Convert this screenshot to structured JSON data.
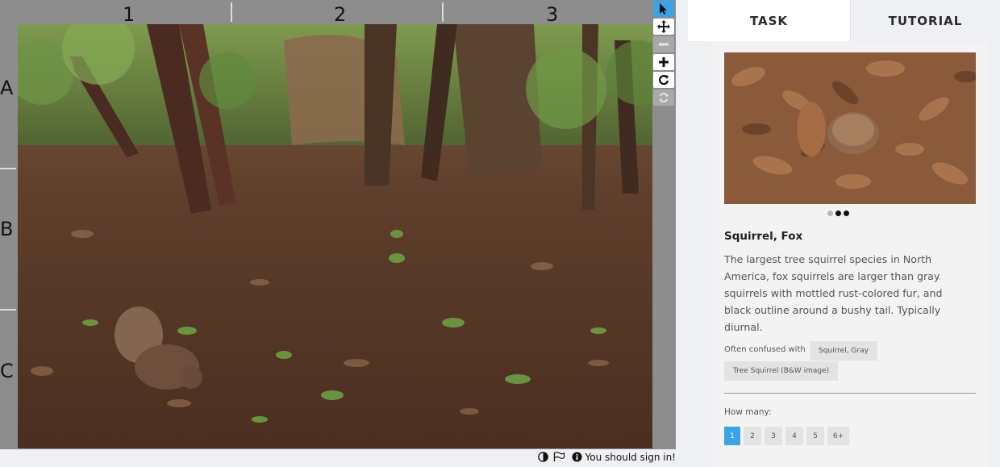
{
  "viewer": {
    "columns": [
      "1",
      "2",
      "3"
    ],
    "rows": [
      "A",
      "B",
      "C"
    ],
    "photo_alt": "Camera trap photo of a squirrel in a wooded area",
    "tools": [
      {
        "name": "pointer-tool",
        "icon": "cursor-arrow-icon",
        "state": "active"
      },
      {
        "name": "pan-tool",
        "icon": "move-arrows-icon",
        "state": "normal"
      },
      {
        "name": "zoom-out-tool",
        "icon": "minus-icon",
        "state": "disabled"
      },
      {
        "name": "zoom-in-tool",
        "icon": "plus-icon",
        "state": "normal"
      },
      {
        "name": "rotate-tool",
        "icon": "rotate-icon",
        "state": "normal"
      },
      {
        "name": "reset-tool",
        "icon": "refresh-icon",
        "state": "disabled"
      }
    ]
  },
  "footer": {
    "sign_in_text": "You should sign in!",
    "icons": [
      "contrast-icon",
      "flag-icon",
      "info-icon"
    ]
  },
  "tabs": [
    {
      "label": "TASK",
      "active": true
    },
    {
      "label": "TUTORIAL",
      "active": false
    }
  ],
  "species": {
    "name": "Squirrel, Fox",
    "description": "The largest tree squirrel species in North America, fox squirrels are larger than gray squirrels with mottled rust-colored fur, and black outline around a bushy tail. Typically diurnal.",
    "carousel_dots": 3,
    "active_dot": 1,
    "confused_label": "Often confused with",
    "confused_with": [
      "Squirrel, Gray",
      "Tree Squirrel (B&W image)"
    ]
  },
  "how_many": {
    "label": "How many:",
    "options": [
      "1",
      "2",
      "3",
      "4",
      "5",
      "6+"
    ],
    "selected": "1"
  },
  "colors": {
    "accent": "#3ba4e8",
    "panel_bg": "#eef0f3",
    "viewer_bg": "#8d8d8d"
  }
}
